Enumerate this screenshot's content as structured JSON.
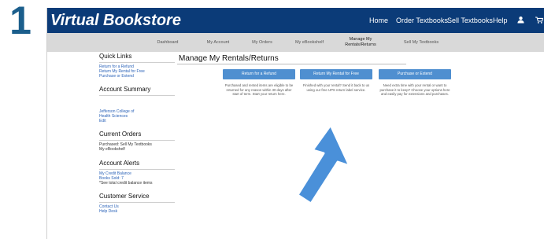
{
  "step_number": "1",
  "header": {
    "logo": "Virtual Bookstore",
    "nav": [
      "Home",
      "Order Textbooks",
      "Sell Textbooks",
      "Help"
    ],
    "cart_count": "(0"
  },
  "account_nav": [
    "Dashboard",
    "My Account",
    "My Orders",
    "My eBookshelf",
    "Manage My Rentals/Returns",
    "Sell My Textbooks"
  ],
  "sidebar": {
    "quick_links_title": "Quick Links",
    "quick_links": [
      "Return for a Refund",
      "Return My Rental for Free",
      "Purchase or Extend"
    ],
    "account_summary_title": "Account Summary",
    "account_summary_lines": [
      "Jefferson College of",
      "Health Sciences",
      "Edit"
    ],
    "current_orders_title": "Current Orders",
    "current_orders_lines": [
      "Purchased: Sell My Textbooks",
      "My eBookshelf"
    ],
    "account_alerts_title": "Account Alerts",
    "account_alerts_links": [
      "My Credit Balance",
      "Books Sold: 7"
    ],
    "account_alerts_note": "*See total credit balance items",
    "customer_service_title": "Customer Service",
    "customer_service_links": [
      "Contact Us",
      "Help Desk"
    ]
  },
  "main": {
    "title": "Manage My Rentals/Returns",
    "actions": [
      {
        "label": "Return for a Refund",
        "description": "Purchased and rented items are eligible to be returned for any reason within 30 days after start of term. Start your return here."
      },
      {
        "label": "Return My Rental for Free",
        "description": "Finished with your rental? Send it back to us using our free UPS return label service."
      },
      {
        "label": "Purchase or Extend",
        "description": "Need extra time with your rental or want to purchase it to keep? Choose your options here and easily pay for extensions and purchases."
      }
    ]
  },
  "colors": {
    "header_bg": "#0b3b78",
    "subnav_bg": "#d9d9d9",
    "button_bg": "#4f8fd0",
    "link": "#2a62b8",
    "step_number": "#1b5e8c",
    "arrow": "#4a90d9"
  },
  "icons": [
    "user-icon",
    "cart-icon",
    "pointer-arrow-icon"
  ]
}
